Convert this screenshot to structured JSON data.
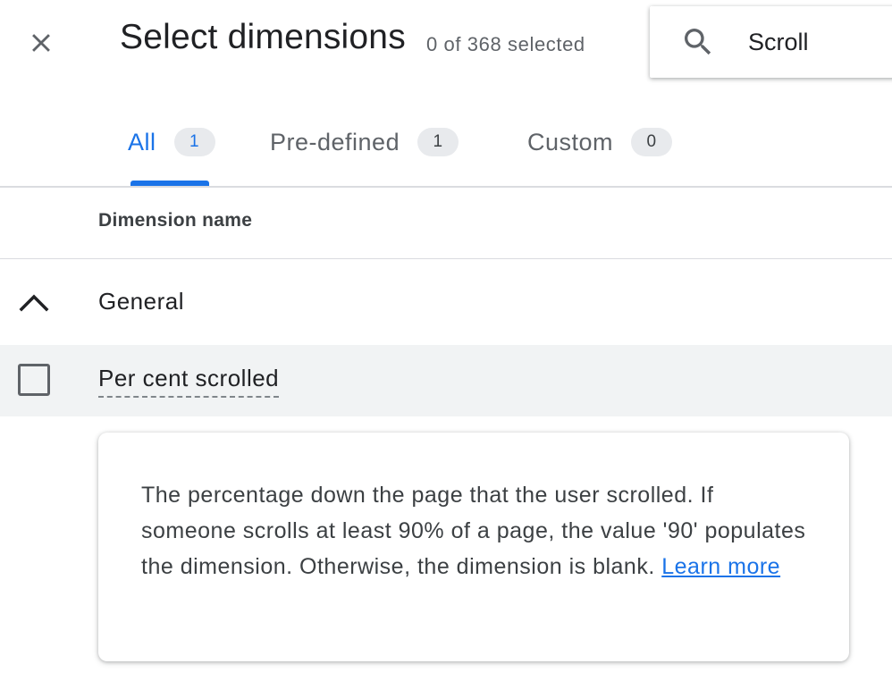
{
  "header": {
    "title": "Select dimensions",
    "selected_count": "0 of 368 selected",
    "close_icon": "close-icon"
  },
  "search": {
    "icon": "search-icon",
    "value": "Scroll"
  },
  "tabs": [
    {
      "label": "All",
      "count": "1",
      "active": true
    },
    {
      "label": "Pre-defined",
      "count": "1",
      "active": false
    },
    {
      "label": "Custom",
      "count": "0",
      "active": false
    }
  ],
  "table": {
    "column_header": "Dimension name",
    "groups": [
      {
        "label": "General",
        "expanded": true,
        "toggle_icon": "chevron-up-icon",
        "items": [
          {
            "label": "Per cent scrolled",
            "checked": false,
            "tooltip": {
              "text": "The percentage down the page that the user scrolled. If someone scrolls at least 90% of a page, the value '90' populates the dimension. Otherwise, the dimension is blank.",
              "link_label": "Learn more"
            }
          }
        ]
      }
    ]
  },
  "colors": {
    "accent": "#1a73e8",
    "row_hover": "#f1f3f4",
    "badge_bg": "#e8eaed"
  }
}
